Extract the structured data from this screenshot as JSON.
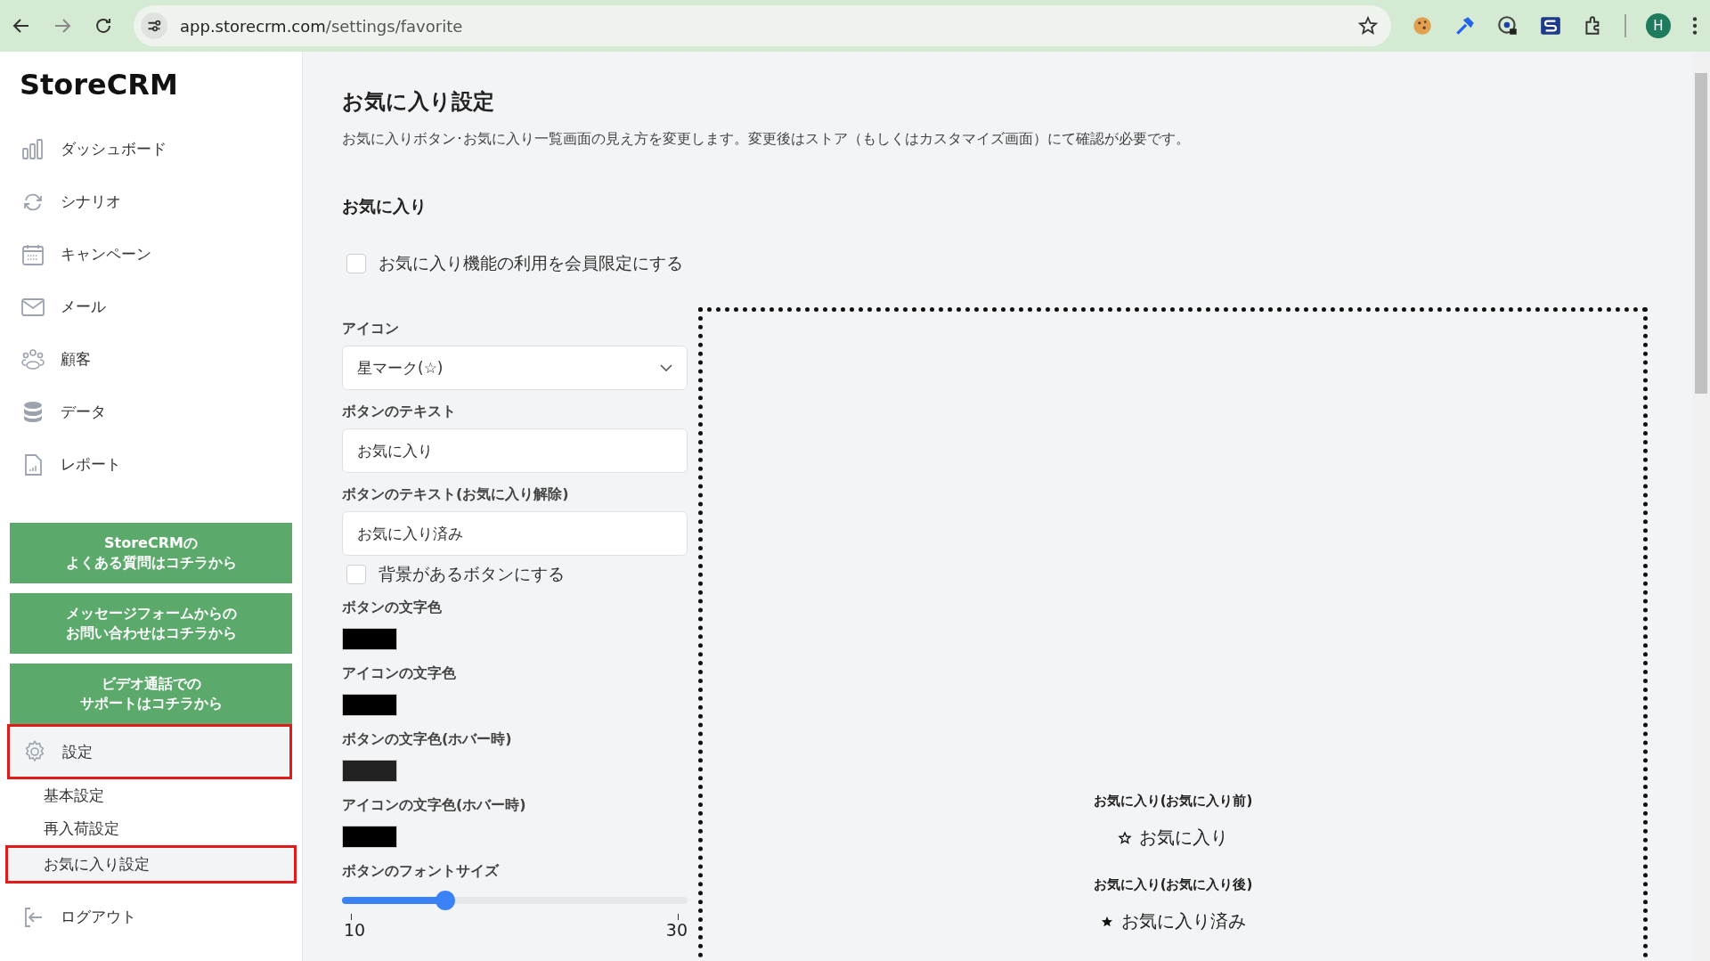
{
  "browser": {
    "url_host": "app.storecrm.com",
    "url_path": "/settings/favorite",
    "avatar": "H"
  },
  "sidebar": {
    "logo": "StoreCRM",
    "nav": [
      {
        "label": "ダッシュボード",
        "kind": "bars"
      },
      {
        "label": "シナリオ",
        "kind": "cycle"
      },
      {
        "label": "キャンペーン",
        "kind": "calendar"
      },
      {
        "label": "メール",
        "kind": "mail"
      },
      {
        "label": "顧客",
        "kind": "people"
      },
      {
        "label": "データ",
        "kind": "database"
      },
      {
        "label": "レポート",
        "kind": "report"
      }
    ],
    "help_buttons": [
      {
        "lines": [
          "StoreCRMの",
          "よくある質問はコチラから"
        ]
      },
      {
        "lines": [
          "メッセージフォームからの",
          "お問い合わせはコチラから"
        ]
      },
      {
        "lines": [
          "ビデオ通話での",
          "サポートはコチラから"
        ]
      }
    ],
    "settings": {
      "label": "設定",
      "selected": true,
      "annotated": true,
      "children": [
        {
          "label": "基本設定",
          "selected": false,
          "annotated": false
        },
        {
          "label": "再入荷設定",
          "selected": false,
          "annotated": false
        },
        {
          "label": "お気に入り設定",
          "selected": true,
          "annotated": true
        }
      ]
    },
    "logout": "ログアウト"
  },
  "main": {
    "title": "お気に入り設定",
    "description": "お気に入りボタン･お気に入り一覧画面の見え方を変更します。変更後はストア（もしくはカスタマイズ画面）にて確認が必要です。",
    "section": "お気に入り",
    "members_only": {
      "label": "お気に入り機能の利用を会員限定にする",
      "checked": false
    },
    "icon_select": {
      "label": "アイコン",
      "value": "星マーク(☆)"
    },
    "text_fields": [
      {
        "label": "ボタンのテキスト",
        "value": "お気に入り"
      },
      {
        "label": "ボタンのテキスト(お気に入り解除)",
        "value": "お気に入り済み"
      }
    ],
    "background_button": {
      "label": "背景があるボタンにする",
      "checked": false
    },
    "colors": [
      {
        "label": "ボタンの文字色",
        "color": "#000000"
      },
      {
        "label": "アイコンの文字色",
        "color": "#000000"
      },
      {
        "label": "ボタンの文字色(ホバー時)",
        "color": "#222222"
      },
      {
        "label": "アイコンの文字色(ホバー時)",
        "color": "#000000"
      }
    ],
    "font_size": {
      "label": "ボタンのフォントサイズ",
      "level": 0.3,
      "min": "10",
      "max": "30"
    },
    "preview": [
      {
        "label": "お気に入り(お気に入り前)",
        "kind": "outline",
        "text": "お気に入り"
      },
      {
        "label": "お気に入り(お気に入り後)",
        "kind": "filled",
        "text": "お気に入り済み"
      }
    ]
  }
}
